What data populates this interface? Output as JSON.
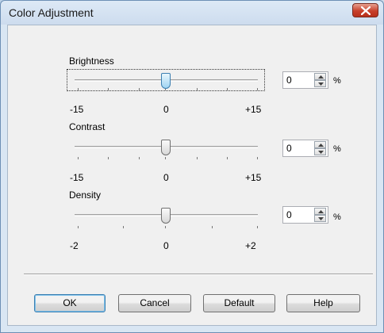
{
  "window": {
    "title": "Color Adjustment"
  },
  "sliders": [
    {
      "label": "Brightness",
      "value": "0",
      "min_label": "-15",
      "mid_label": "0",
      "max_label": "+15",
      "unit": "%",
      "min": -15,
      "max": 15,
      "current": 0
    },
    {
      "label": "Contrast",
      "value": "0",
      "min_label": "-15",
      "mid_label": "0",
      "max_label": "+15",
      "unit": "%",
      "min": -15,
      "max": 15,
      "current": 0
    },
    {
      "label": "Density",
      "value": "0",
      "min_label": "-2",
      "mid_label": "0",
      "max_label": "+2",
      "unit": "%",
      "min": -2,
      "max": 2,
      "current": 0
    }
  ],
  "buttons": {
    "ok": "OK",
    "cancel": "Cancel",
    "default": "Default",
    "help": "Help"
  },
  "icons": {
    "close": "close-icon",
    "spin_up": "spin-up-arrow-icon",
    "spin_down": "spin-down-arrow-icon"
  },
  "colors": {
    "close_button": "#c7402b",
    "active_thumb": "#9fd4f2"
  }
}
